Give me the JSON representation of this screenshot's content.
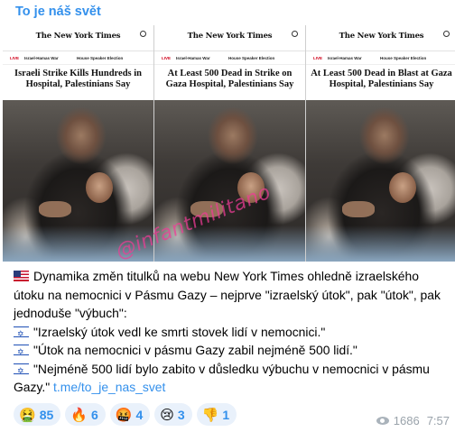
{
  "channel": {
    "name": "To je náš svět"
  },
  "nyt": {
    "logo": "The New York Times",
    "live": "LIVE",
    "nav_item_1": "Israel-Hamas War",
    "nav_item_2": "House Speaker Election"
  },
  "panels": [
    {
      "headline": "Israeli Strike Kills Hundreds in Hospital, Palestinians Say"
    },
    {
      "headline": "At Least 500 Dead in Strike on Gaza Hospital, Palestinians Say"
    },
    {
      "headline": "At Least 500 Dead in Blast at Gaza Hospital, Palestinians Say"
    }
  ],
  "watermark": "@infantmilitano",
  "message": {
    "intro": "Dynamika změn titulků na webu New York Times ohledně izraelského útoku na nemocnici v Pásmu Gazy – nejprve \"izraelský útok\", pak \"útok\", pak jednoduše \"výbuch\":",
    "line1": "\"Izraelský útok vedl ke smrti stovek lidí v nemocnici.\"",
    "line2": "\"Útok na nemocnici v pásmu Gazy zabil nejméně 500 lidí.\"",
    "line3": "\"Nejméně 500 lidí bylo zabito v důsledku výbuchu v nemocnici v pásmu Gazy.\"",
    "link": "t.me/to_je_nas_svet"
  },
  "flags": {
    "intro": "us-flag-icon",
    "lines": "israel-flag-icon"
  },
  "reactions": [
    {
      "emoji": "🤮",
      "count": "85"
    },
    {
      "emoji": "🔥",
      "count": "6"
    },
    {
      "emoji": "🤬",
      "count": "4"
    },
    {
      "emoji": "😢",
      "count": "3"
    },
    {
      "emoji": "👎",
      "count": "1"
    }
  ],
  "views": "1686",
  "time": "7:57",
  "colors": {
    "accent": "#3390ec",
    "reaction_bg": "#e9f1fb",
    "meta": "#9aa3ab"
  }
}
